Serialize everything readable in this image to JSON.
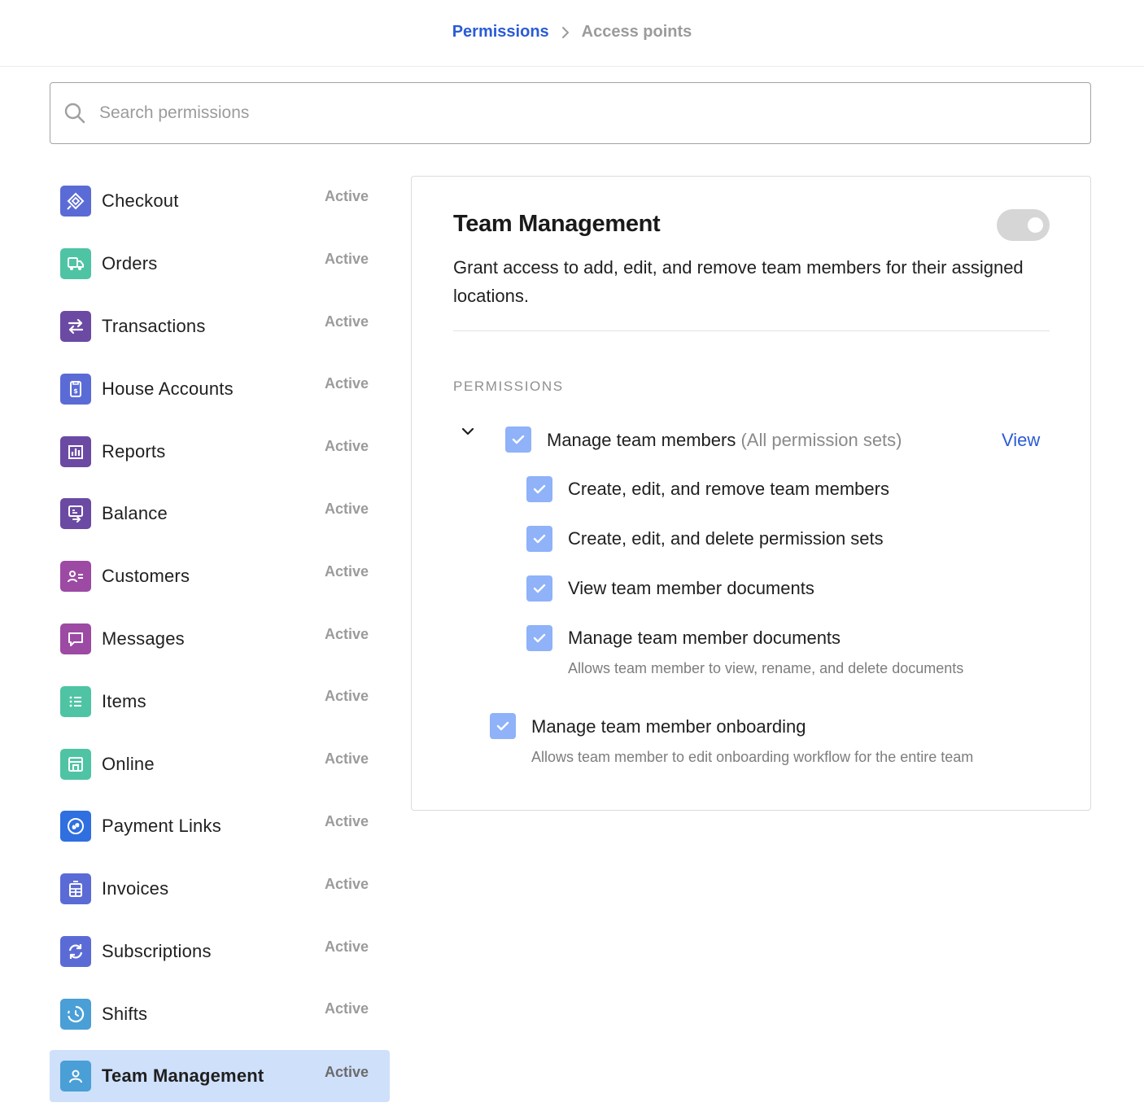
{
  "breadcrumb": {
    "parent": "Permissions",
    "current": "Access points"
  },
  "search": {
    "placeholder": "Search permissions",
    "value": ""
  },
  "sidebar": {
    "items": [
      {
        "label": "Checkout",
        "status": "Active",
        "icon": "checkout-icon",
        "color": "#5b6bd6"
      },
      {
        "label": "Orders",
        "status": "Active",
        "icon": "truck-icon",
        "color": "#4fc4a4"
      },
      {
        "label": "Transactions",
        "status": "Active",
        "icon": "arrows-icon",
        "color": "#6b4aa3"
      },
      {
        "label": "House Accounts",
        "status": "Active",
        "icon": "house-account-icon",
        "color": "#5b6bd6"
      },
      {
        "label": "Reports",
        "status": "Active",
        "icon": "bar-chart-icon",
        "color": "#6b4aa3"
      },
      {
        "label": "Balance",
        "status": "Active",
        "icon": "balance-icon",
        "color": "#6b4aa3"
      },
      {
        "label": "Customers",
        "status": "Active",
        "icon": "customer-card-icon",
        "color": "#9c4aa3"
      },
      {
        "label": "Messages",
        "status": "Active",
        "icon": "message-icon",
        "color": "#9c4aa3"
      },
      {
        "label": "Items",
        "status": "Active",
        "icon": "list-icon",
        "color": "#4fc4a4"
      },
      {
        "label": "Online",
        "status": "Active",
        "icon": "storefront-icon",
        "color": "#4fc4a4"
      },
      {
        "label": "Payment Links",
        "status": "Active",
        "icon": "link-icon",
        "color": "#2f6fe0"
      },
      {
        "label": "Invoices",
        "status": "Active",
        "icon": "invoice-icon",
        "color": "#5b6bd6"
      },
      {
        "label": "Subscriptions",
        "status": "Active",
        "icon": "refresh-icon",
        "color": "#5b6bd6"
      },
      {
        "label": "Shifts",
        "status": "Active",
        "icon": "clock-icon",
        "color": "#4a9fd6"
      },
      {
        "label": "Team Management",
        "status": "Active",
        "icon": "person-icon",
        "color": "#4a9fd6",
        "selected": true
      }
    ]
  },
  "panel": {
    "title": "Team Management",
    "toggle_on": false,
    "description": "Grant access to add, edit, and remove team members for their assigned locations.",
    "section_label": "PERMISSIONS",
    "group": {
      "label": "Manage team members",
      "sub": "(All permission sets)",
      "view_link": "View",
      "checked": true,
      "children": [
        {
          "label": "Create, edit, and remove team members",
          "checked": true
        },
        {
          "label": "Create, edit, and delete permission sets",
          "checked": true
        },
        {
          "label": "View team member documents",
          "checked": true
        },
        {
          "label": "Manage team member documents",
          "checked": true,
          "help": "Allows team member to view, rename, and delete documents"
        }
      ]
    },
    "onboarding": {
      "label": "Manage team member onboarding",
      "checked": true,
      "help": "Allows team member to edit onboarding workflow for the entire team"
    }
  },
  "colors": {
    "accent": "#2a5bd7",
    "checkbox": "#8fb2f8",
    "selected_bg": "#cfe0fb"
  }
}
